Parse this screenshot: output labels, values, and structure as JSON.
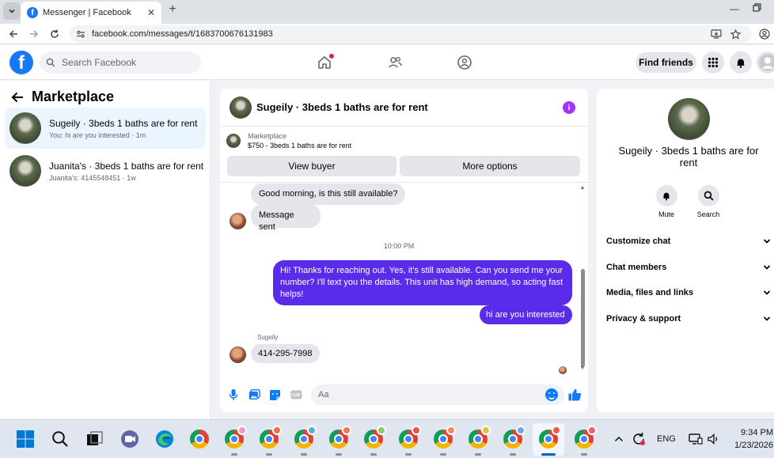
{
  "browser": {
    "tab_title": "Messenger | Facebook",
    "url": "facebook.com/messages/t/1683700676131983"
  },
  "header": {
    "logo_letter": "f",
    "search_placeholder": "Search Facebook",
    "find_friends": "Find friends"
  },
  "left_panel": {
    "title": "Marketplace",
    "conversations": [
      {
        "name": "Sugeily · 3beds 1 baths are for rent",
        "preview": "You: hi are you interested · 1m",
        "active": true
      },
      {
        "name": "Juanita's · 3beds 1 baths are for rent",
        "preview": "Juanita's: 4145548451 · 1w",
        "active": false
      }
    ]
  },
  "chat": {
    "title": "Sugeily · 3beds 1 baths are for rent",
    "marketplace_label": "Marketplace",
    "listing": "$750 - 3beds 1 baths are for rent",
    "view_buyer": "View buyer",
    "more_options": "More options",
    "messages": [
      {
        "text": "Good morning, is this still available?"
      },
      {
        "text": "Message sent"
      },
      {
        "text": "Hi! Thanks for reaching out. Yes, it's still available. Can you send me your number? I'll text you the details. This unit has high demand, so acting fast helps!"
      },
      {
        "text": "hi are you interested"
      },
      {
        "text": "414-295-7998"
      }
    ],
    "timestamp": "10:00 PM",
    "sender_name": "Sugeily",
    "input_placeholder": "Aa"
  },
  "right_panel": {
    "name": "Sugeily · 3beds 1 baths are for rent",
    "mute_label": "Mute",
    "search_label": "Search",
    "menu": [
      "Customize chat",
      "Chat members",
      "Media, files and links",
      "Privacy & support"
    ]
  },
  "taskbar": {
    "language": "ENG",
    "time": "9:34 PM",
    "date": "1/23/2026"
  },
  "colors": {
    "brand_blue": "#1877f2",
    "outgoing_bubble": "#5b2bea",
    "incoming_bubble": "#e4e6eb",
    "active_conversation": "#ebf5ff"
  },
  "icons": [
    "tab-list-icon",
    "facebook-favicon",
    "close-icon",
    "new-tab-icon",
    "minimize-icon",
    "restore-icon",
    "back-icon",
    "forward-icon",
    "reload-icon",
    "site-info-icon",
    "install-icon",
    "bookmark-star-icon",
    "profile-icon",
    "search-icon",
    "home-icon",
    "friends-icon",
    "groups-icon",
    "menu-grid-icon",
    "bell-icon",
    "back-arrow-icon",
    "info-icon",
    "microphone-icon",
    "image-icon",
    "sticker-icon",
    "gif-icon",
    "emoji-icon",
    "like-icon",
    "chevron-down-icon",
    "windows-start-icon",
    "taskbar-search-icon",
    "task-view-icon",
    "teams-icon",
    "edge-icon",
    "chrome-icon",
    "chevron-up-icon",
    "refresh-icon",
    "display-icon",
    "speaker-icon"
  ]
}
